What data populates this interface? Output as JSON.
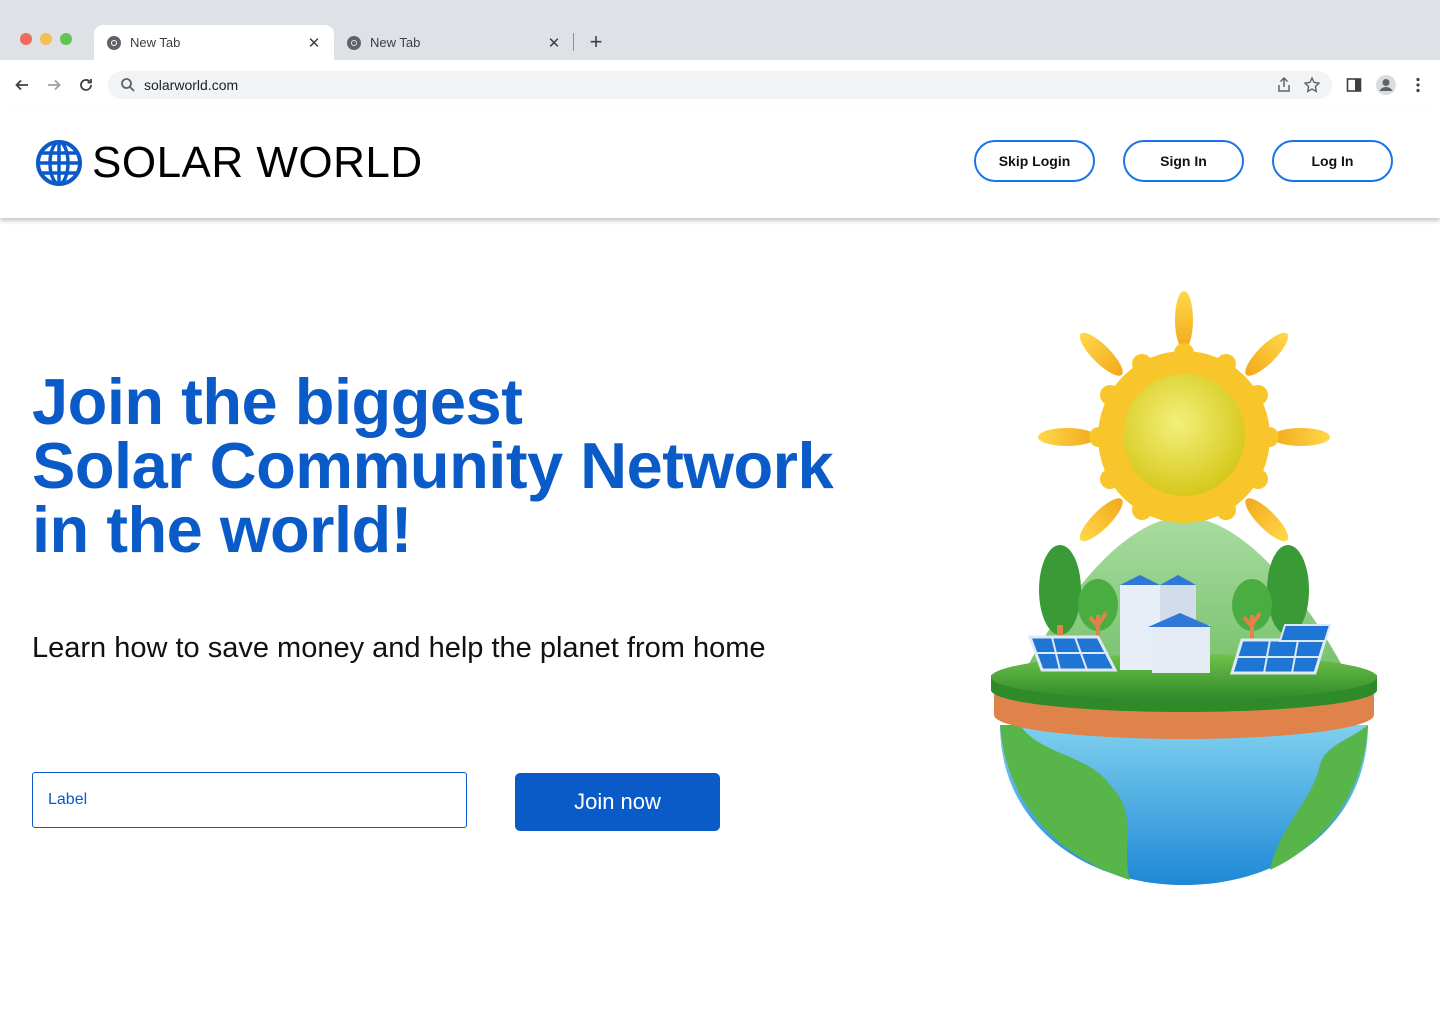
{
  "browser": {
    "tabs": [
      {
        "title": "New Tab",
        "active": true
      },
      {
        "title": "New Tab",
        "active": false
      }
    ],
    "new_tab_symbol": "+",
    "close_symbol": "✕",
    "url": "solarworld.com",
    "icons": [
      "back-icon",
      "forward-icon",
      "reload-icon",
      "search-icon",
      "share-icon",
      "star-icon",
      "sidepanel-icon",
      "profile-icon",
      "menu-icon"
    ]
  },
  "header": {
    "brand": "SOLAR WORLD",
    "logo_icon": "globe-icon",
    "buttons": {
      "skip_login": "Skip Login",
      "sign_in": "Sign In",
      "log_in": "Log In"
    },
    "accent_color": "#1a73e8"
  },
  "hero": {
    "title_lines": [
      "Join the biggest",
      "Solar Community Network",
      "in the world!"
    ],
    "subtitle": "Learn how to save money and help the planet from home",
    "input_placeholder": "Label",
    "cta_label": "Join now",
    "brand_color": "#0a5ac8",
    "illustration": "solar-earth-illustration"
  }
}
